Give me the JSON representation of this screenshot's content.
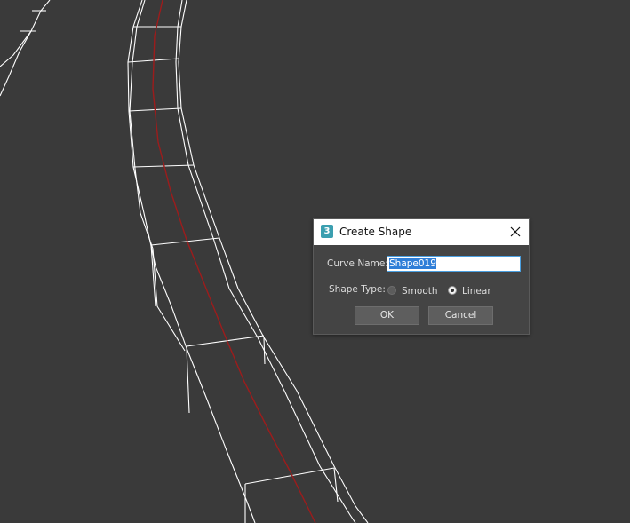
{
  "dialog": {
    "title": "Create Shape",
    "app_icon_glyph": "3",
    "curve_name_label": "Curve Name:",
    "curve_name_value": "Shape019",
    "shape_type_label": "Shape Type:",
    "shape_type_options": [
      {
        "label": "Smooth",
        "selected": false
      },
      {
        "label": "Linear",
        "selected": true
      }
    ],
    "ok_label": "OK",
    "cancel_label": "Cancel",
    "icons": {
      "app": "3dsmax-app-icon",
      "close": "close-icon"
    }
  },
  "colors": {
    "viewport_bg": "#3a3a3a",
    "wire": "#ffffff",
    "spline": "#9c1c1c",
    "selection": "#2f7ed8"
  }
}
